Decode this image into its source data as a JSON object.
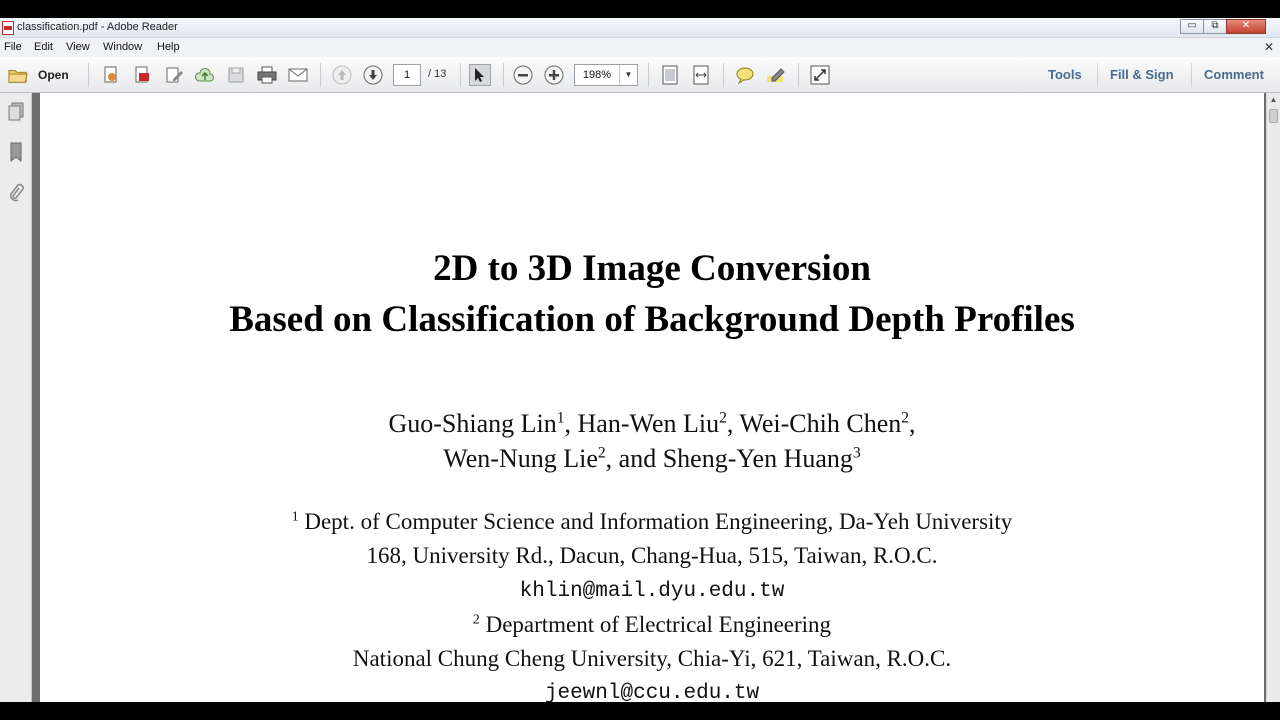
{
  "window": {
    "title": "classification.pdf - Adobe Reader",
    "controls": {
      "minimize": "▭",
      "restore": "⧉",
      "close": "✕"
    }
  },
  "menu": {
    "items": [
      "File",
      "Edit",
      "View",
      "Window",
      "Help"
    ],
    "close_glyph": "✕"
  },
  "toolbar": {
    "open_label": "Open",
    "page_current": "1",
    "page_total": "/ 13",
    "zoom": "198%",
    "zoom_arrow": "▼",
    "right_buttons": [
      "Tools",
      "Fill & Sign",
      "Comment"
    ],
    "icons": [
      "open-folder-icon",
      "create-pdf-icon",
      "export-pdf-icon",
      "edit-pdf-icon",
      "cloud-upload-icon",
      "save-icon",
      "print-icon",
      "email-icon",
      "previous-page-icon",
      "next-page-icon",
      "select-tool-icon",
      "zoom-out-icon",
      "zoom-in-icon",
      "fit-page-icon",
      "fit-width-icon",
      "sticky-note-icon",
      "highlight-icon",
      "fullscreen-icon"
    ]
  },
  "nav_pane": {
    "icons": [
      "page-thumbnails-icon",
      "bookmarks-icon",
      "attachments-icon"
    ]
  },
  "document": {
    "title_line1": "2D to 3D Image Conversion",
    "title_line2": "Based on Classification of Background Depth Profiles",
    "authors": {
      "a1": "Guo-Shiang Lin",
      "a1_sup": "1",
      "a2": ", Han-Wen Liu",
      "a2_sup": "2",
      "a3": ", Wei-Chih Chen",
      "a3_sup": "2",
      "a3_trail": ",",
      "a4": "Wen-Nung Lie",
      "a4_sup": "2",
      "a5": ", and Sheng-Yen Huang",
      "a5_sup": "3"
    },
    "affiliation1": {
      "sup": "1",
      "name": " Dept. of Computer Science and Information Engineering, Da-Yeh University",
      "address": "168, University Rd., Dacun, Chang-Hua, 515, Taiwan, R.O.C.",
      "email": "khlin@mail.dyu.edu.tw"
    },
    "affiliation2": {
      "sup": "2",
      "name": " Department of Electrical Engineering",
      "address": "National Chung Cheng University, Chia-Yi, 621, Taiwan, R.O.C.",
      "email": "jeewnl@ccu.edu.tw"
    }
  },
  "scrollbar": {
    "up_arrow": "▲"
  }
}
